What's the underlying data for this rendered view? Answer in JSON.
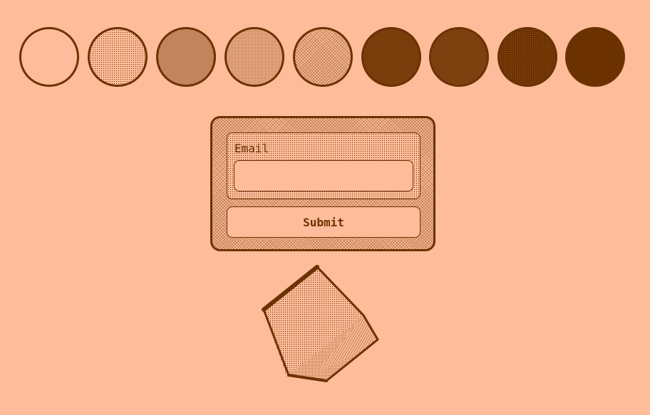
{
  "palette": {
    "background": "#ffbc9a",
    "ink": "#6b3200"
  },
  "swatches": [
    {
      "name": "swatch-blank",
      "fill": "empty"
    },
    {
      "name": "swatch-sparse-dots",
      "fill": "sparse-dots"
    },
    {
      "name": "swatch-fine-dots",
      "fill": "fine-dots"
    },
    {
      "name": "swatch-light-checker",
      "fill": "light-checker"
    },
    {
      "name": "swatch-crosshatch",
      "fill": "crosshatch"
    },
    {
      "name": "swatch-dense-dots",
      "fill": "dense-dots"
    },
    {
      "name": "swatch-darker-dots",
      "fill": "darker-dots"
    },
    {
      "name": "swatch-dark-grid",
      "fill": "dark-grid"
    },
    {
      "name": "swatch-solid",
      "fill": "solid"
    }
  ],
  "form": {
    "email_label": "Email",
    "email_value": "",
    "email_placeholder": "",
    "submit_label": "Submit"
  },
  "illustration": {
    "name": "dithered-pentagonal-prism"
  }
}
